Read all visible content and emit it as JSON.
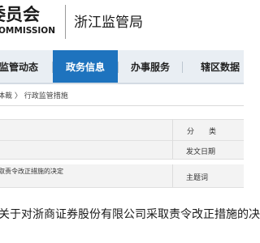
{
  "header": {
    "logo_cn": "委员会",
    "logo_en": "OMMISSION",
    "bureau": "浙江监管局"
  },
  "nav": {
    "items": [
      {
        "label": "监管动态",
        "active": false
      },
      {
        "label": "政务信息",
        "active": true
      },
      {
        "label": "办事服务",
        "active": false
      },
      {
        "label": "辖区数据",
        "active": false
      }
    ]
  },
  "breadcrumb": {
    "home": "体裁",
    "separator": "〉",
    "current": "行政监管措施"
  },
  "info_table": {
    "category_label": "分　　类",
    "date_label": "发文日期",
    "doc_title_short": "取责令改正措施的决定",
    "subject_label": "主题词"
  },
  "article": {
    "title": "关于对浙商证券股份有限公司采取责令改正措施的决定"
  }
}
